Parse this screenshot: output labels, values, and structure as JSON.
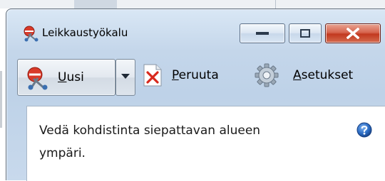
{
  "window": {
    "title": "Leikkaustyökalu"
  },
  "toolbar": {
    "new_label": "Uusi",
    "new_accesskey": "U",
    "new_rest": "usi",
    "cancel_accesskey": "P",
    "cancel_rest": "eruuta",
    "settings_accesskey": "A",
    "settings_rest": "setukset"
  },
  "message": {
    "text": "Vedä kohdistinta siepattavan alueen\nympäri."
  },
  "icons": {
    "app": "scissors-icon",
    "new": "scissors-icon",
    "dropdown": "chevron-down-icon",
    "cancel": "cancel-doc-icon",
    "settings": "gear-icon",
    "help": "help-icon"
  },
  "colors": {
    "close_button": "#c2391f",
    "help_icon": "#1f5fb8"
  }
}
